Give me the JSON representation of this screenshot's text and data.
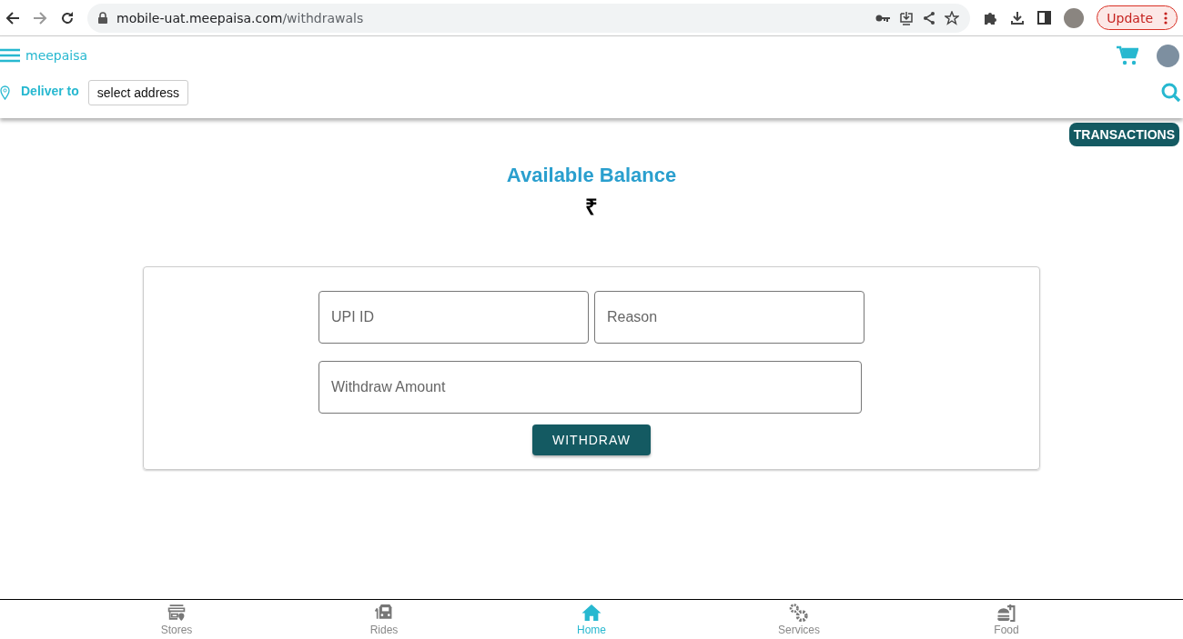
{
  "browser": {
    "url_host": "mobile-uat.meepaisa.com",
    "url_path": "/withdrawals",
    "update_label": "Update"
  },
  "header": {
    "logo": "meepaisa",
    "deliver_label": "Deliver to",
    "address_button": "select address"
  },
  "transactions_button": "TRANSACTIONS",
  "balance": {
    "title": "Available Balance",
    "currency": "₹"
  },
  "form": {
    "fields": [
      {
        "placeholder": "UPI ID"
      },
      {
        "placeholder": "Reason"
      },
      {
        "placeholder": "Withdraw Amount"
      }
    ],
    "submit": "WITHDRAW"
  },
  "bottom_nav": [
    {
      "kind": "stores",
      "label": "Stores",
      "selected": false
    },
    {
      "kind": "rides",
      "label": "Rides",
      "selected": false
    },
    {
      "kind": "home",
      "label": "Home",
      "selected": true
    },
    {
      "kind": "services",
      "label": "Services",
      "selected": false
    },
    {
      "kind": "food",
      "label": "Food",
      "selected": false
    }
  ]
}
